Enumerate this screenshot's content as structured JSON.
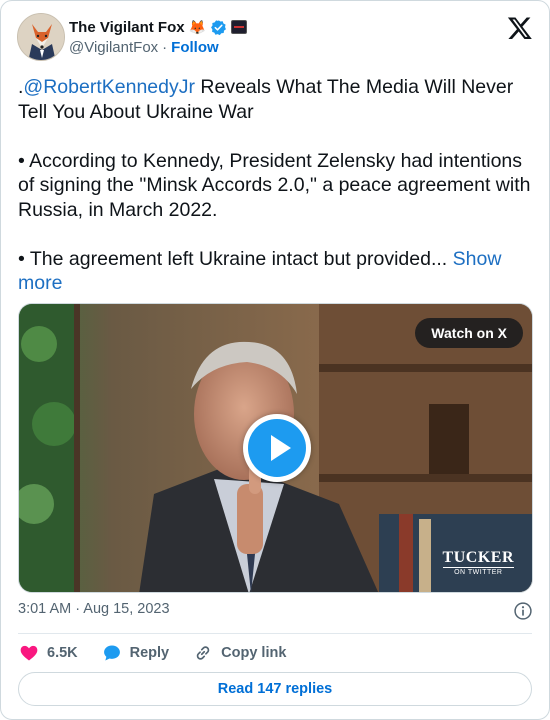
{
  "author": {
    "display_name": "The Vigilant Fox",
    "emoji": "🦊",
    "handle": "@VigilantFox",
    "separator": "·",
    "follow_label": "Follow"
  },
  "tweet": {
    "mention": "@RobertKennedyJr",
    "line1_prefix": ".",
    "line1_rest": " Reveals What The Media Will Never Tell You About Ukraine War",
    "para2": "• According to Kennedy, President Zelensky had intentions of signing the \"Minsk Accords 2.0,\" a peace agreement with Russia, in March 2022.",
    "para3": "• The agreement left Ukraine intact but provided... ",
    "show_more": "Show more"
  },
  "media": {
    "watch_label": "Watch on X",
    "watermark_main": "TUCKER",
    "watermark_sub": "ON TWITTER"
  },
  "meta": {
    "timestamp": "3:01 AM · Aug 15, 2023"
  },
  "actions": {
    "likes": "6.5K",
    "reply_label": "Reply",
    "copy_link_label": "Copy link",
    "read_replies_label": "Read 147 replies"
  },
  "colors": {
    "accent": "#1d9bf0",
    "link": "#006fd6",
    "like": "#f91880",
    "text": "#0f1419",
    "muted": "#536471"
  }
}
